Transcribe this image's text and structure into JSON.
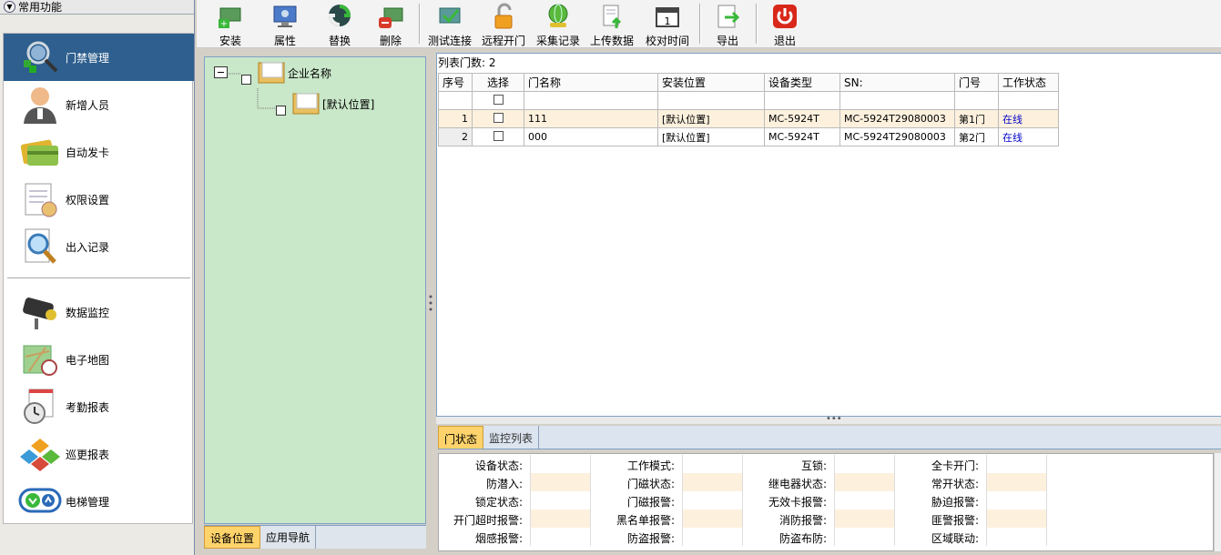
{
  "nav": {
    "header": "常用功能",
    "items": [
      {
        "label": "门禁管理",
        "icon": "access-control-icon"
      },
      {
        "label": "新增人员",
        "icon": "person-icon"
      },
      {
        "label": "自动发卡",
        "icon": "card-icon"
      },
      {
        "label": "权限设置",
        "icon": "permission-icon"
      },
      {
        "label": "出入记录",
        "icon": "record-search-icon"
      },
      {
        "label": "数据监控",
        "icon": "camera-icon"
      },
      {
        "label": "电子地图",
        "icon": "map-icon"
      },
      {
        "label": "考勤报表",
        "icon": "clock-icon"
      },
      {
        "label": "巡更报表",
        "icon": "patrol-icon"
      },
      {
        "label": "电梯管理",
        "icon": "elevator-icon"
      }
    ]
  },
  "toolbar": {
    "install": "安装",
    "properties": "属性",
    "replace": "替换",
    "delete": "删除",
    "test_connection": "测试连接",
    "remote_open": "远程开门",
    "collect_records": "采集记录",
    "upload_data": "上传数据",
    "sync_time": "校对时间",
    "sync_time_day": "1",
    "export": "导出",
    "exit": "退出"
  },
  "tree": {
    "root": "企业名称",
    "child": "[默认位置]",
    "tabs": [
      "设备位置",
      "应用导航"
    ]
  },
  "grid": {
    "count_label": "列表门数: 2",
    "columns": [
      "序号",
      "选择",
      "门名称",
      "安装位置",
      "设备类型",
      "SN:",
      "门号",
      "工作状态"
    ],
    "rows": [
      {
        "no": "1",
        "name": "111",
        "location": "[默认位置]",
        "type": "MC-5924T",
        "sn": "MC-5924T29080003",
        "door": "第1门",
        "status": "在线"
      },
      {
        "no": "2",
        "name": "000",
        "location": "[默认位置]",
        "type": "MC-5924T",
        "sn": "MC-5924T29080003",
        "door": "第2门",
        "status": "在线"
      }
    ],
    "status_color": "#0000c8"
  },
  "status": {
    "tabs": [
      "门状态",
      "监控列表"
    ],
    "rows": [
      [
        "设备状态:",
        "工作模式:",
        "互锁:",
        "全卡开门:"
      ],
      [
        "防潜入:",
        "门磁状态:",
        "继电器状态:",
        "常开状态:"
      ],
      [
        "锁定状态:",
        "门磁报警:",
        "无效卡报警:",
        "胁迫报警:"
      ],
      [
        "开门超时报警:",
        "黑名单报警:",
        "消防报警:",
        "匪警报警:"
      ],
      [
        "烟感报警:",
        "防盗报警:",
        "防盗布防:",
        "区域联动:"
      ]
    ]
  },
  "colors": {
    "nav_active": "#2e5f8e",
    "tree_bg": "#c9e7c9",
    "tab_active": "#ffd36b",
    "row_alt": "#fdf1de"
  }
}
